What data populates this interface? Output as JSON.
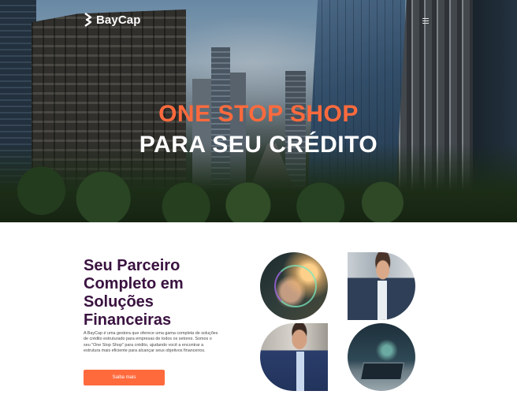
{
  "header": {
    "brand_name": "BayCap",
    "logo_icon": "baycap-logo-icon",
    "menu_icon": "hamburger-menu-icon"
  },
  "hero": {
    "title_line_1": "ONE STOP SHOP",
    "title_line_2": "PARA SEU CRÉDITO",
    "title_line_1_color": "#ff6a3d",
    "title_line_2_color": "#ffffff"
  },
  "about": {
    "heading_lines": [
      "Seu Parceiro",
      "Completo em",
      "Soluções",
      "Financeiras"
    ],
    "description": "A BayCap é uma gestora que oferece uma gama completa de soluções de crédito estruturado para empresas de todos os setores. Somos o seu \"One Stop Shop\" para crédito, ajudando você a encontrar a estrutura mais eficiente para alcançar seus objetivos financeiros.",
    "cta_label": "Saiba mais",
    "heading_color": "#3a1240",
    "accent_color": "#ff6a3d"
  },
  "gallery": {
    "images": [
      "handshake-photo",
      "businessman-phone-photo",
      "businessman-suit-photo",
      "laptop-hands-photo"
    ]
  }
}
